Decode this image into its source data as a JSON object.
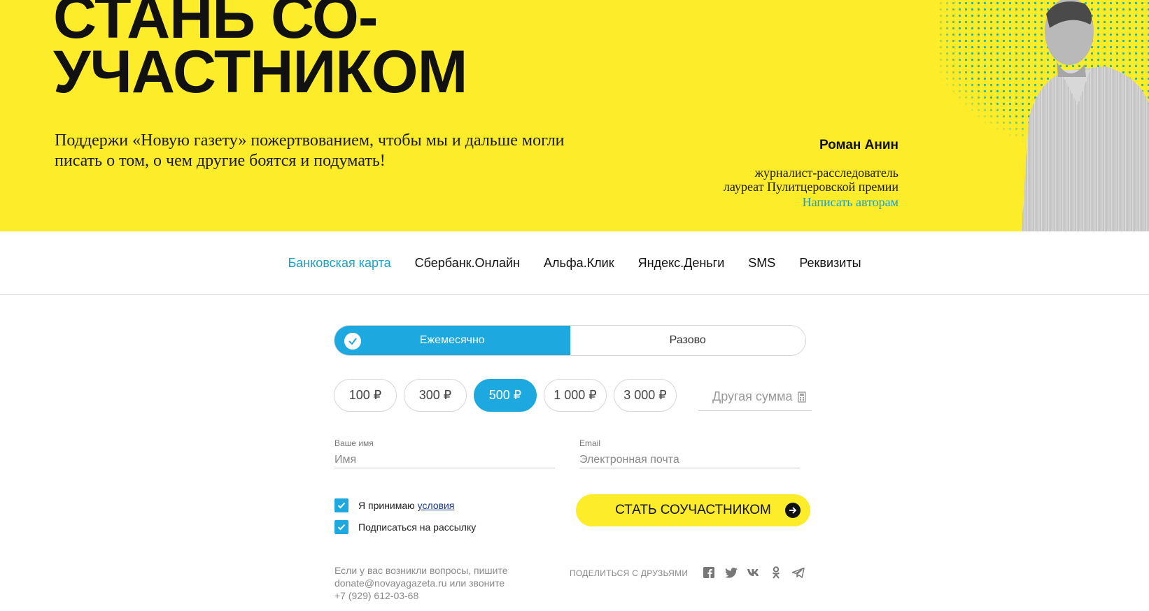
{
  "hero": {
    "title_line1": "СТАНЬ СО-",
    "title_line2": "УЧАСТНИКОМ",
    "subtitle": "Поддержи «Новую газету» пожертвованием, чтобы мы и дальше могли писать о том, о чем другие боятся и подумать!",
    "author_name": "Роман Анин",
    "author_role1": "журналист-расследователь",
    "author_role2": "лауреат Пулитцеровской премии",
    "author_link": "Написать авторам",
    "background_color": "#fdec2a",
    "link_color": "#1aa0c8"
  },
  "tabs": [
    {
      "label": "Банковская карта",
      "active": true
    },
    {
      "label": "Сбербанк.Онлайн"
    },
    {
      "label": "Альфа.Клик"
    },
    {
      "label": "Яндекс.Деньги"
    },
    {
      "label": "SMS"
    },
    {
      "label": "Реквизиты"
    }
  ],
  "frequency": {
    "monthly": "Ежемесячно",
    "once": "Разово",
    "selected": "monthly",
    "accent": "#1da9e0"
  },
  "amounts": [
    {
      "label": "100 ₽"
    },
    {
      "label": "300 ₽"
    },
    {
      "label": "500 ₽",
      "selected": true
    },
    {
      "label": "1 000 ₽"
    },
    {
      "label": "3 000 ₽"
    }
  ],
  "other_sum": {
    "placeholder": "Другая сумма"
  },
  "form": {
    "name_label": "Ваше имя",
    "name_placeholder": "Имя",
    "email_label": "Email",
    "email_placeholder": "Электронная почта",
    "accept_text": "Я принимаю",
    "accept_link": "условия",
    "subscribe_text": "Подписаться на рассылку",
    "submit_label": "СТАТЬ СОУЧАСТНИКОМ"
  },
  "footer": {
    "contact_line1": "Если у вас возникли вопросы, пишите",
    "contact_line2": "donate@novayagazeta.ru или звоните",
    "contact_line3": "+7 (929) 612-03-68",
    "share_label": "ПОДЕЛИТЬСЯ С ДРУЗЬЯМИ",
    "socials": [
      "facebook-icon",
      "twitter-icon",
      "vk-icon",
      "odnoklassniki-icon",
      "telegram-icon"
    ]
  }
}
